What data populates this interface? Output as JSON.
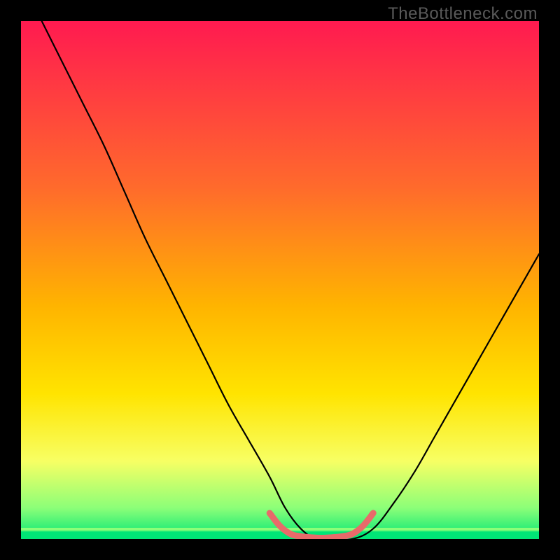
{
  "watermark": "TheBottleneck.com",
  "colors": {
    "black": "#000000",
    "gradient_top": "#ff1a50",
    "gradient_mid1": "#ff6a2c",
    "gradient_mid2": "#ffb400",
    "gradient_mid3": "#ffe400",
    "gradient_bottom1": "#f7ff64",
    "gradient_bottom2": "#8cff78",
    "gradient_bottom3": "#00e676",
    "curve": "#000000",
    "bottom_accent": "#e86a6a"
  },
  "chart_data": {
    "type": "line",
    "title": "",
    "xlabel": "",
    "ylabel": "",
    "xlim": [
      0,
      100
    ],
    "ylim": [
      0,
      100
    ],
    "series": [
      {
        "name": "bottleneck-curve",
        "x": [
          4,
          8,
          12,
          16,
          20,
          24,
          28,
          32,
          36,
          40,
          44,
          48,
          51,
          54,
          57,
          60,
          64,
          68,
          72,
          76,
          80,
          84,
          88,
          92,
          96,
          100
        ],
        "values": [
          100,
          92,
          84,
          76,
          67,
          58,
          50,
          42,
          34,
          26,
          19,
          12,
          6,
          2,
          0,
          0,
          0,
          2,
          7,
          13,
          20,
          27,
          34,
          41,
          48,
          55
        ]
      },
      {
        "name": "optimal-band",
        "x": [
          48,
          50,
          52,
          54,
          56,
          58,
          60,
          62,
          64,
          66,
          68
        ],
        "values": [
          5,
          2.5,
          1,
          0.5,
          0.3,
          0.2,
          0.3,
          0.5,
          1,
          2.5,
          5
        ]
      }
    ]
  }
}
